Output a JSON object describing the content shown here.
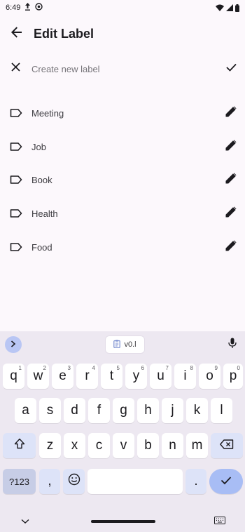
{
  "status_bar": {
    "time": "6:49"
  },
  "app_bar": {
    "title": "Edit Label"
  },
  "new_label": {
    "placeholder": "Create new label"
  },
  "labels": [
    {
      "name": "Meeting"
    },
    {
      "name": "Job"
    },
    {
      "name": "Book"
    },
    {
      "name": "Health"
    },
    {
      "name": "Food"
    }
  ],
  "keyboard": {
    "clipboard_chip": "v0.l",
    "row1": [
      {
        "k": "q",
        "h": "1"
      },
      {
        "k": "w",
        "h": "2"
      },
      {
        "k": "e",
        "h": "3"
      },
      {
        "k": "r",
        "h": "4"
      },
      {
        "k": "t",
        "h": "5"
      },
      {
        "k": "y",
        "h": "6"
      },
      {
        "k": "u",
        "h": "7"
      },
      {
        "k": "i",
        "h": "8"
      },
      {
        "k": "o",
        "h": "9"
      },
      {
        "k": "p",
        "h": "0"
      }
    ],
    "row2": [
      "a",
      "s",
      "d",
      "f",
      "g",
      "h",
      "j",
      "k",
      "l"
    ],
    "row3": [
      "z",
      "x",
      "c",
      "v",
      "b",
      "n",
      "m"
    ],
    "symbols_key": "?123",
    "comma_key": ",",
    "period_key": "."
  },
  "colors": {
    "background": "#fcf8fc",
    "keyboard_bg": "#ede8f1",
    "accent": "#a8bdf5"
  },
  "icons": {
    "back": "arrow-left-icon",
    "close": "close-icon",
    "confirm": "check-icon",
    "label": "label-outline-icon",
    "edit": "pencil-icon"
  }
}
